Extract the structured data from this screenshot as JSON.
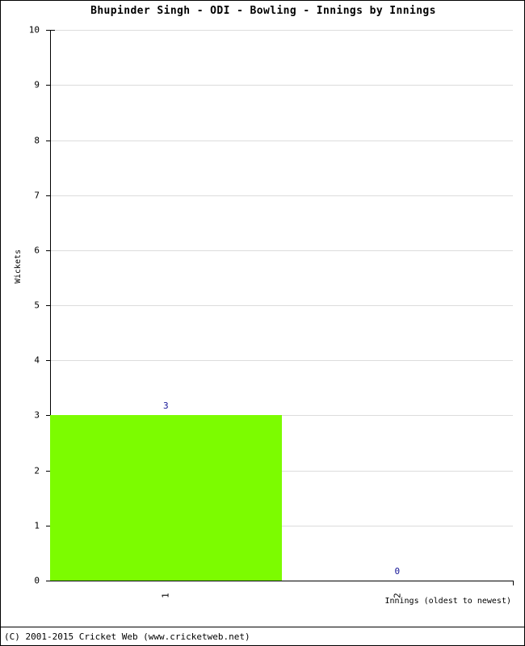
{
  "chart_data": {
    "type": "bar",
    "title": "Bhupinder Singh - ODI - Bowling - Innings by Innings",
    "xlabel": "Innings (oldest to newest)",
    "ylabel": "Wickets",
    "categories": [
      "1",
      "2"
    ],
    "values": [
      3,
      0
    ],
    "data_labels": [
      "3",
      "0"
    ],
    "ylim": [
      0,
      10
    ],
    "y_ticks": [
      0,
      1,
      2,
      3,
      4,
      5,
      6,
      7,
      8,
      9,
      10
    ],
    "y_tick_labels": [
      "0",
      "1",
      "2",
      "3",
      "4",
      "5",
      "6",
      "7",
      "8",
      "9",
      "10"
    ],
    "grid": true,
    "legend": false,
    "bar_color": "#7cfc00",
    "label_color": "#141496",
    "grid_color": "#dcdcdc",
    "axis_color": "#000000"
  },
  "footer": {
    "copyright": "(C) 2001-2015 Cricket Web (www.cricketweb.net)"
  }
}
